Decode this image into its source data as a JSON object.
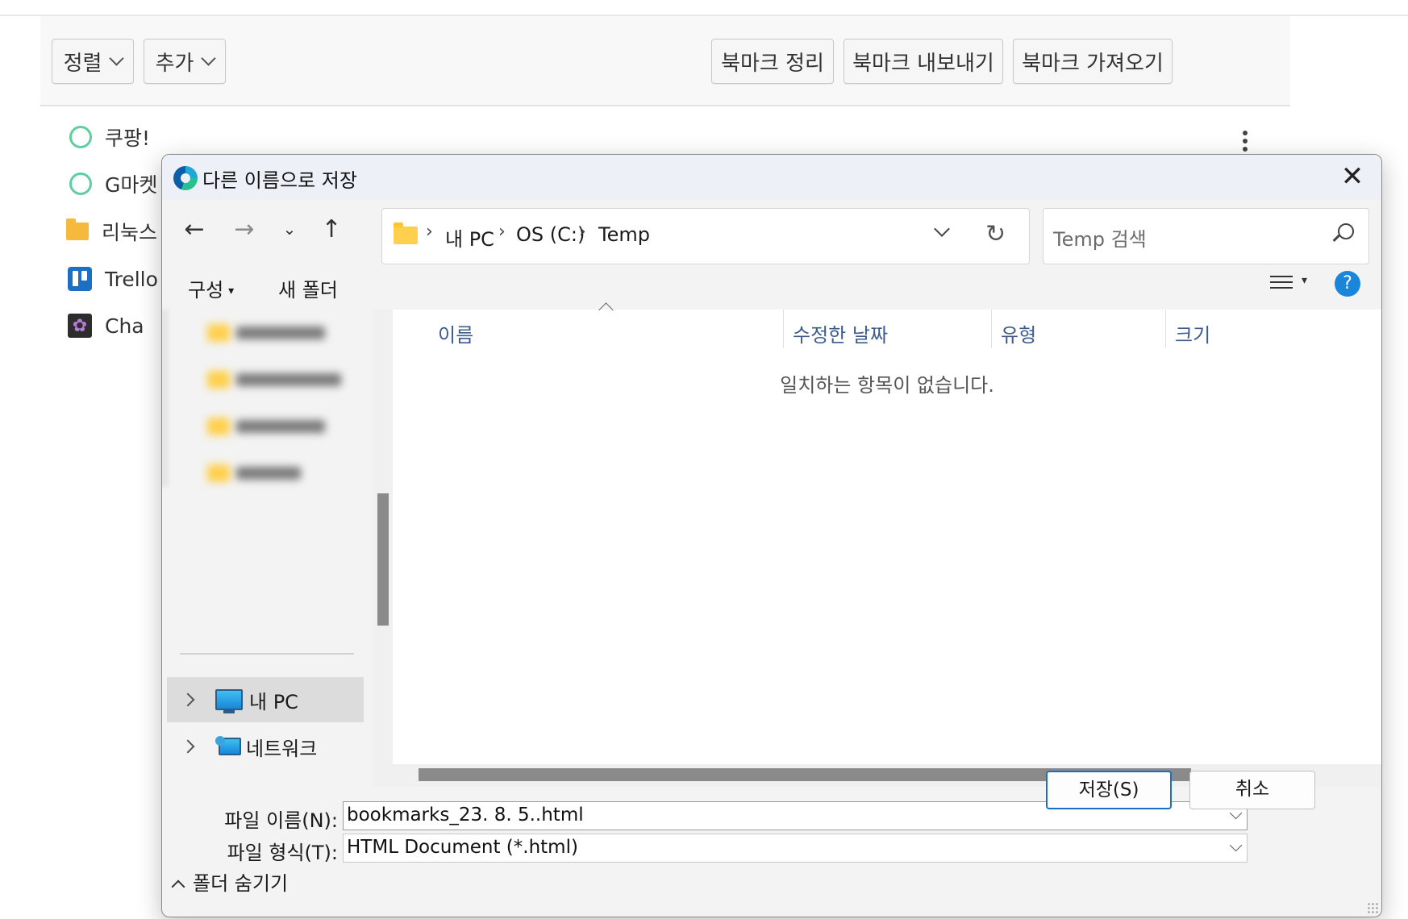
{
  "toolbar": {
    "sort_label": "정렬",
    "add_label": "추가",
    "organize_label": "북마크 정리",
    "export_label": "북마크 내보내기",
    "import_label": "북마크 가져오기"
  },
  "bookmarks": [
    {
      "label": "쿠팡!",
      "icon": "ring-icon"
    },
    {
      "label": "G마켓",
      "icon": "ring-icon"
    },
    {
      "label": "리눅스",
      "icon": "folder-icon"
    },
    {
      "label": "Trello",
      "icon": "trello-icon"
    },
    {
      "label": "Cha",
      "icon": "chatgpt-icon"
    }
  ],
  "dialog": {
    "title": "다른 이름으로 저장",
    "breadcrumb": [
      "내 PC",
      "OS (C:)",
      "Temp"
    ],
    "search_placeholder": "Temp 검색",
    "organize_label": "구성",
    "new_folder_label": "새 폴더",
    "help_label": "?",
    "nav_tree": [
      {
        "label": "내 PC",
        "icon": "computer-icon",
        "selected": true
      },
      {
        "label": "네트워크",
        "icon": "network-icon",
        "selected": false
      }
    ],
    "columns": [
      "이름",
      "수정한 날짜",
      "유형",
      "크기"
    ],
    "empty_message": "일치하는 항목이 없습니다.",
    "file_name_label": "파일 이름(N):",
    "file_name_value": "bookmarks_23. 8. 5..html",
    "file_type_label": "파일 형식(T):",
    "file_type_value": "HTML Document (*.html)",
    "hide_folders_label": "폴더 숨기기",
    "save_label": "저장(S)",
    "cancel_label": "취소"
  },
  "colors": {
    "accent": "#1a6fc9",
    "ring": "#5ecf9e",
    "folder": "#f6b93b",
    "column_header": "#3d5c8b"
  }
}
